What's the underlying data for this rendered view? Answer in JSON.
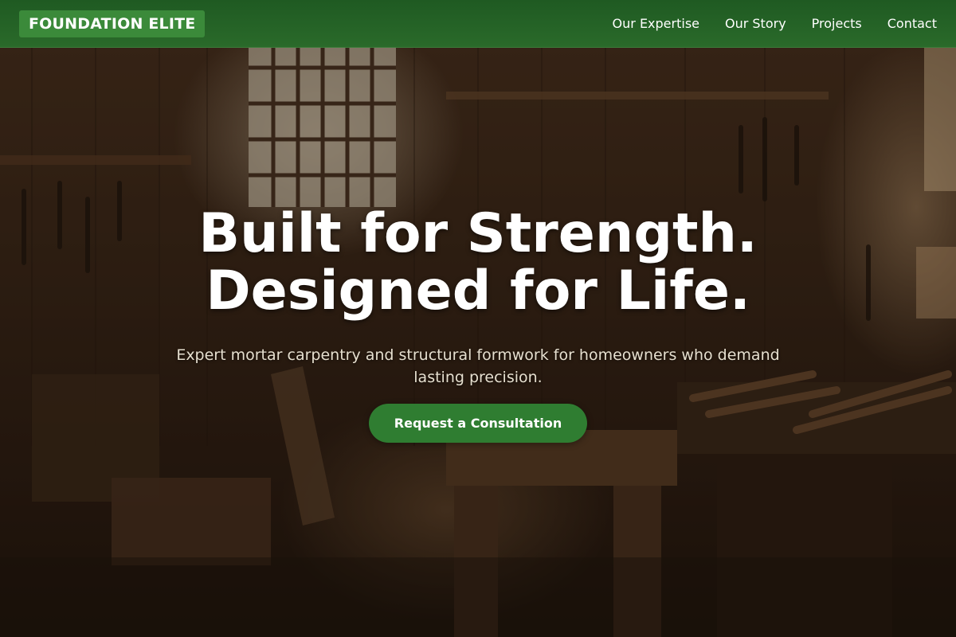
{
  "header": {
    "logo_text": "FOUNDATION ELITE",
    "nav": [
      {
        "label": "Our Expertise"
      },
      {
        "label": "Our Story"
      },
      {
        "label": "Projects"
      },
      {
        "label": "Contact"
      }
    ]
  },
  "hero": {
    "headline_line1": "Built for Strength.",
    "headline_line2": "Designed for Life.",
    "subtext": "Expert mortar carpentry and structural formwork for homeowners who demand lasting precision.",
    "cta_label": "Request a Consultation",
    "background_image": "woodworking-workshop-photo"
  },
  "colors": {
    "header_bg": "#2a6a2a",
    "logo_bg": "#3b8a3a",
    "cta_bg": "#2f7d31",
    "headline": "#ffffff",
    "subtext": "#e6dfcf"
  }
}
